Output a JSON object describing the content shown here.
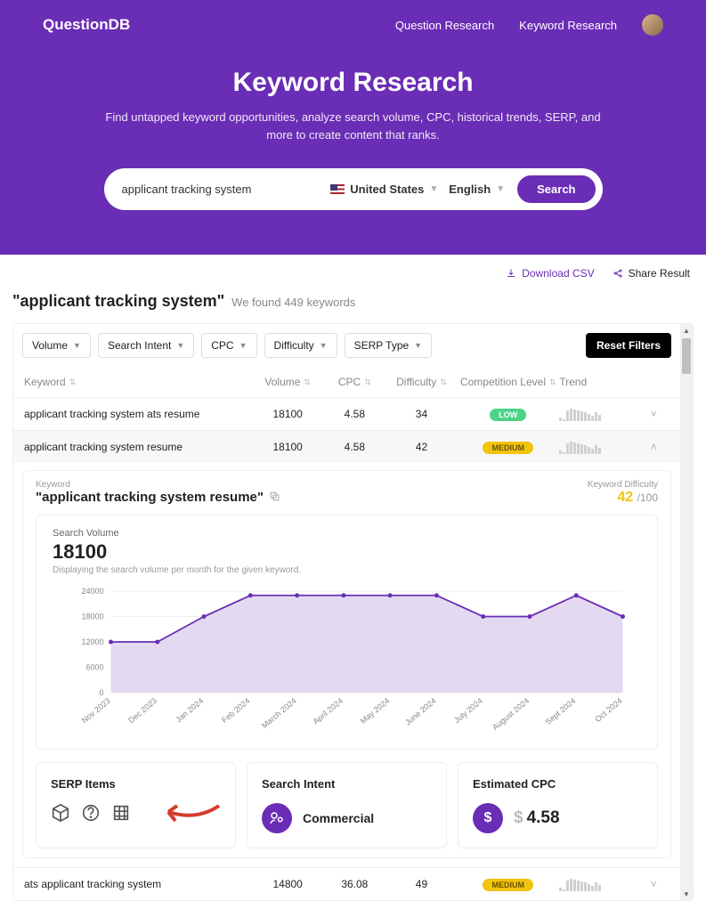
{
  "brand": "QuestionDB",
  "nav": {
    "question": "Question Research",
    "keyword": "Keyword Research"
  },
  "hero": {
    "title": "Keyword Research",
    "subtitle": "Find untapped keyword opportunities, analyze search volume, CPC, historical trends, SERP, and more to create content that ranks."
  },
  "search": {
    "query": "applicant tracking system",
    "country": "United States",
    "language": "English",
    "button": "Search"
  },
  "actions": {
    "download": "Download CSV",
    "share": "Share Result"
  },
  "results": {
    "keyword": "\"applicant tracking system\"",
    "count_text": "We found 449 keywords"
  },
  "filters": {
    "volume": "Volume",
    "intent": "Search Intent",
    "cpc": "CPC",
    "difficulty": "Difficulty",
    "serp": "SERP Type",
    "reset": "Reset Filters"
  },
  "columns": {
    "keyword": "Keyword",
    "volume": "Volume",
    "cpc": "CPC",
    "difficulty": "Difficulty",
    "competition": "Competition Level",
    "trend": "Trend"
  },
  "rows": [
    {
      "keyword": "applicant tracking system ats resume",
      "volume": "18100",
      "cpc": "4.58",
      "difficulty": "34",
      "comp": "LOW",
      "comp_class": "low"
    },
    {
      "keyword": "applicant tracking system resume",
      "volume": "18100",
      "cpc": "4.58",
      "difficulty": "42",
      "comp": "MEDIUM",
      "comp_class": "med"
    },
    {
      "keyword": "ats applicant tracking system",
      "volume": "14800",
      "cpc": "36.08",
      "difficulty": "49",
      "comp": "MEDIUM",
      "comp_class": "med"
    }
  ],
  "detail": {
    "label": "Keyword",
    "keyword": "\"applicant tracking system resume\"",
    "kd_label": "Keyword Difficulty",
    "kd_value": "42",
    "kd_total": "/100"
  },
  "chart": {
    "title": "Search Volume",
    "value": "18100",
    "desc": "Displaying the search volume per month for the given keyword."
  },
  "chart_data": {
    "type": "area",
    "title": "Search Volume",
    "xlabel": "",
    "ylabel": "",
    "ylim": [
      0,
      24000
    ],
    "y_ticks": [
      0,
      6000,
      12000,
      18000,
      24000
    ],
    "categories": [
      "Nov 2023",
      "Dec 2023",
      "Jan 2024",
      "Feb 2024",
      "March 2024",
      "April 2024",
      "May 2024",
      "June 2024",
      "July 2024",
      "August 2024",
      "Sept 2024",
      "Oct 2024"
    ],
    "values": [
      12000,
      12000,
      18000,
      23000,
      23000,
      23000,
      23000,
      23000,
      18000,
      18000,
      23000,
      18000
    ]
  },
  "cards": {
    "serp_title": "SERP Items",
    "intent_title": "Search Intent",
    "intent_value": "Commercial",
    "cpc_title": "Estimated CPC",
    "cpc_value": "4.58"
  }
}
